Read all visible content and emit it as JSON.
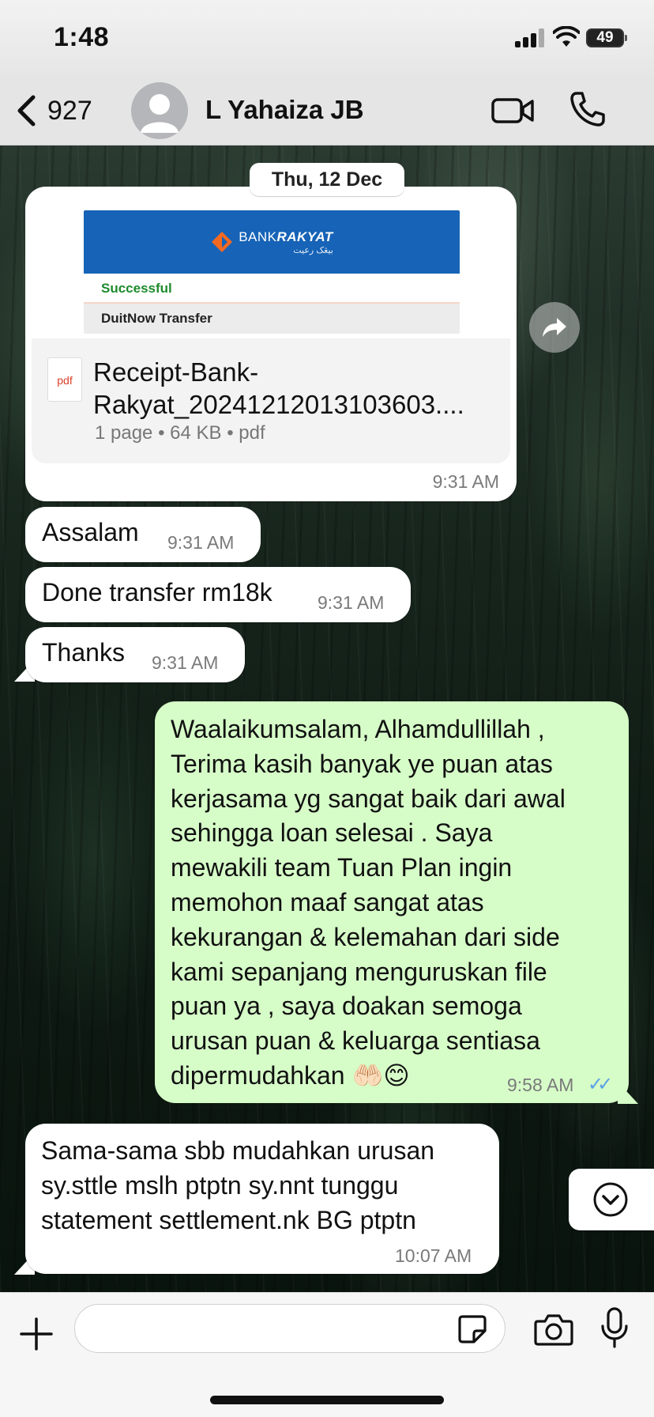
{
  "status_bar": {
    "time": "1:48",
    "battery": "49"
  },
  "header": {
    "back_count": "927",
    "contact_name": "L Yahaiza JB"
  },
  "date_separator": "Thu, 12 Dec",
  "messages": [
    {
      "type": "document",
      "direction": "incoming",
      "preview": {
        "bank_name_light": "BANK",
        "bank_name_bold": "RAKYAT",
        "bank_jawi": "بيڠک رعيت",
        "status": "Successful",
        "transfer_type": "DuitNow Transfer"
      },
      "pdf_label": "pdf",
      "file_name": "Receipt-Bank-Rakyat_20241212013103603....",
      "meta": "1 page • 64 KB • pdf",
      "time": "9:31 AM"
    },
    {
      "type": "text",
      "direction": "incoming",
      "text": "Assalam",
      "time": "9:31 AM"
    },
    {
      "type": "text",
      "direction": "incoming",
      "text": "Done transfer rm18k",
      "time": "9:31 AM"
    },
    {
      "type": "text",
      "direction": "incoming",
      "text": "Thanks",
      "time": "9:31 AM"
    },
    {
      "type": "text",
      "direction": "outgoing",
      "lines": [
        "Waalaikumsalam, Alhamdullillah ,",
        "Terima kasih banyak ye puan atas",
        "kerjasama yg sangat baik dari awal",
        "sehingga loan selesai . Saya",
        "mewakili team Tuan Plan ingin",
        "memohon maaf sangat atas",
        "kekurangan & kelemahan dari side",
        "kami sepanjang menguruskan file",
        "puan ya , saya doakan semoga",
        "urusan puan & keluarga sentiasa",
        "dipermudahkan 🤲🏻😊"
      ],
      "time": "9:58 AM",
      "read_receipt": "✓✓"
    },
    {
      "type": "text",
      "direction": "incoming",
      "lines": [
        "Sama-sama sbb mudahkan urusan",
        "sy.sttle mslh ptptn sy.nnt tunggu",
        "statement settlement.nk BG ptptn"
      ],
      "time": "10:07 AM"
    }
  ],
  "composer": {
    "value": "",
    "placeholder": ""
  },
  "colors": {
    "outgoing_bubble": "#d6fdc8",
    "incoming_bubble": "#ffffff",
    "bank_blue": "#1663b7",
    "success_green": "#1e8b2e",
    "read_tick": "#5aa0e8"
  }
}
